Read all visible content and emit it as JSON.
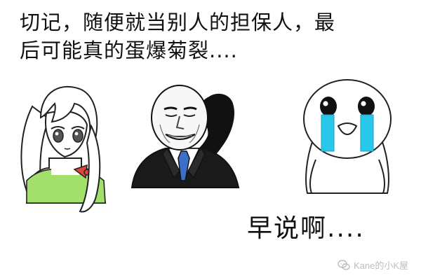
{
  "caption": {
    "top": "切记，随便就当别人的担保人，最\n后可能真的蛋爆菊裂....",
    "bottom": "早说啊...."
  },
  "watermark": {
    "text": "Kane的小K屋"
  },
  "colors": {
    "text": "#111111",
    "girl_collar": "#a2e06b",
    "girl_bow": "#e0463c",
    "tie": "#3b70c8",
    "tears": "#29c7e9",
    "watermark": "#bdbdbd"
  }
}
